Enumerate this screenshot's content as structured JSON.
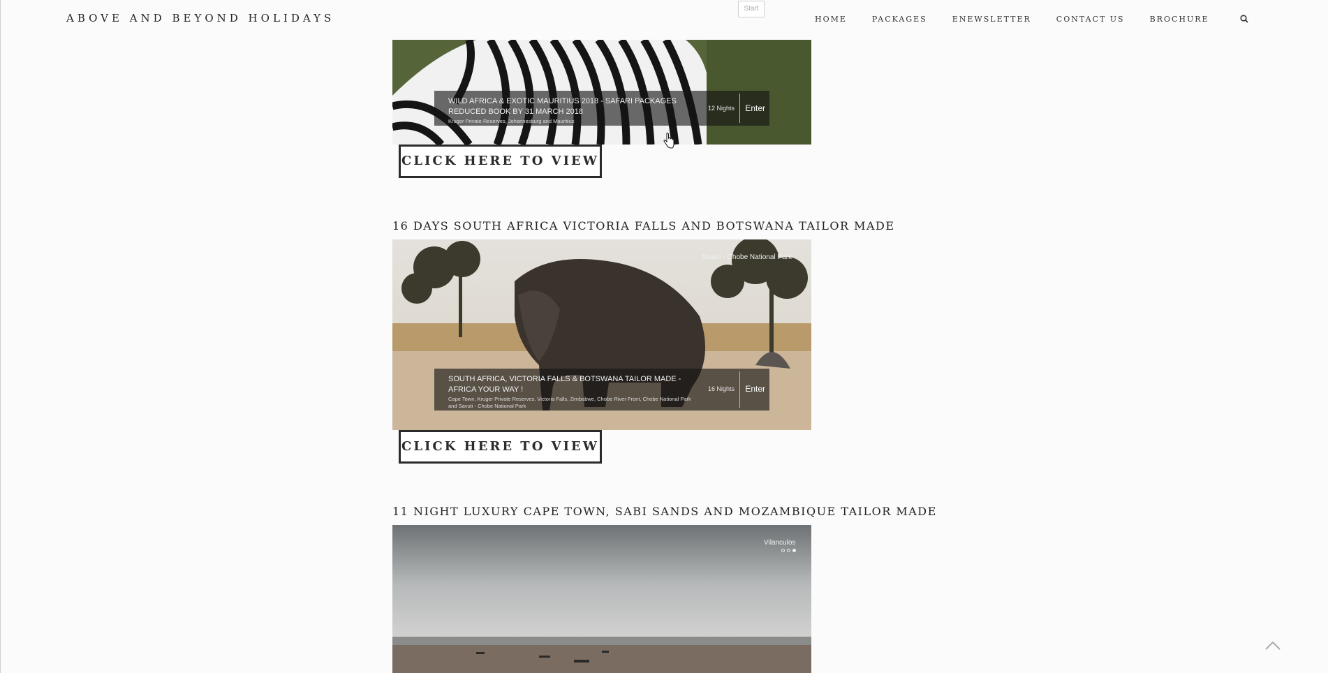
{
  "header": {
    "brand": "ABOVE AND BEYOND HOLIDAYS",
    "start_tab": "Start",
    "nav": [
      "HOME",
      "PACKAGES",
      "ENEWSLETTER",
      "CONTACT US",
      "BROCHURE"
    ],
    "search_icon": "search-icon"
  },
  "packages": [
    {
      "caption_title": "WILD AFRICA & EXOTIC MAURITIUS 2018 - SAFARI PACKAGES REDUCED BOOK BY 31 MARCH 2018",
      "caption_sub": "Kruger Private Reserves, Johannesburg and Mauritius",
      "nights": "12 Nights",
      "enter": "Enter",
      "button": "CLICK HERE TO VIEW"
    },
    {
      "title": "16 DAYS SOUTH AFRICA VICTORIA FALLS AND BOTSWANA TAILOR MADE",
      "photo_label": "Savuti - Chobe National Park",
      "caption_title": "SOUTH AFRICA, VICTORIA FALLS & BOTSWANA TAILOR MADE - AFRICA YOUR WAY !",
      "caption_sub": "Cape Town, Kruger Private Reserves, Victoria Falls, Zimbabwe, Chobe River Front, Chobe National Park and Savuti - Chobe National Park",
      "nights": "16 Nights",
      "enter": "Enter",
      "button": "CLICK HERE TO VIEW"
    },
    {
      "title": "11 NIGHT LUXURY CAPE TOWN, SABI SANDS AND MOZAMBIQUE TAILOR MADE",
      "photo_label": "Vilanculos"
    }
  ],
  "scroll_top_icon": "chevron-up-icon"
}
